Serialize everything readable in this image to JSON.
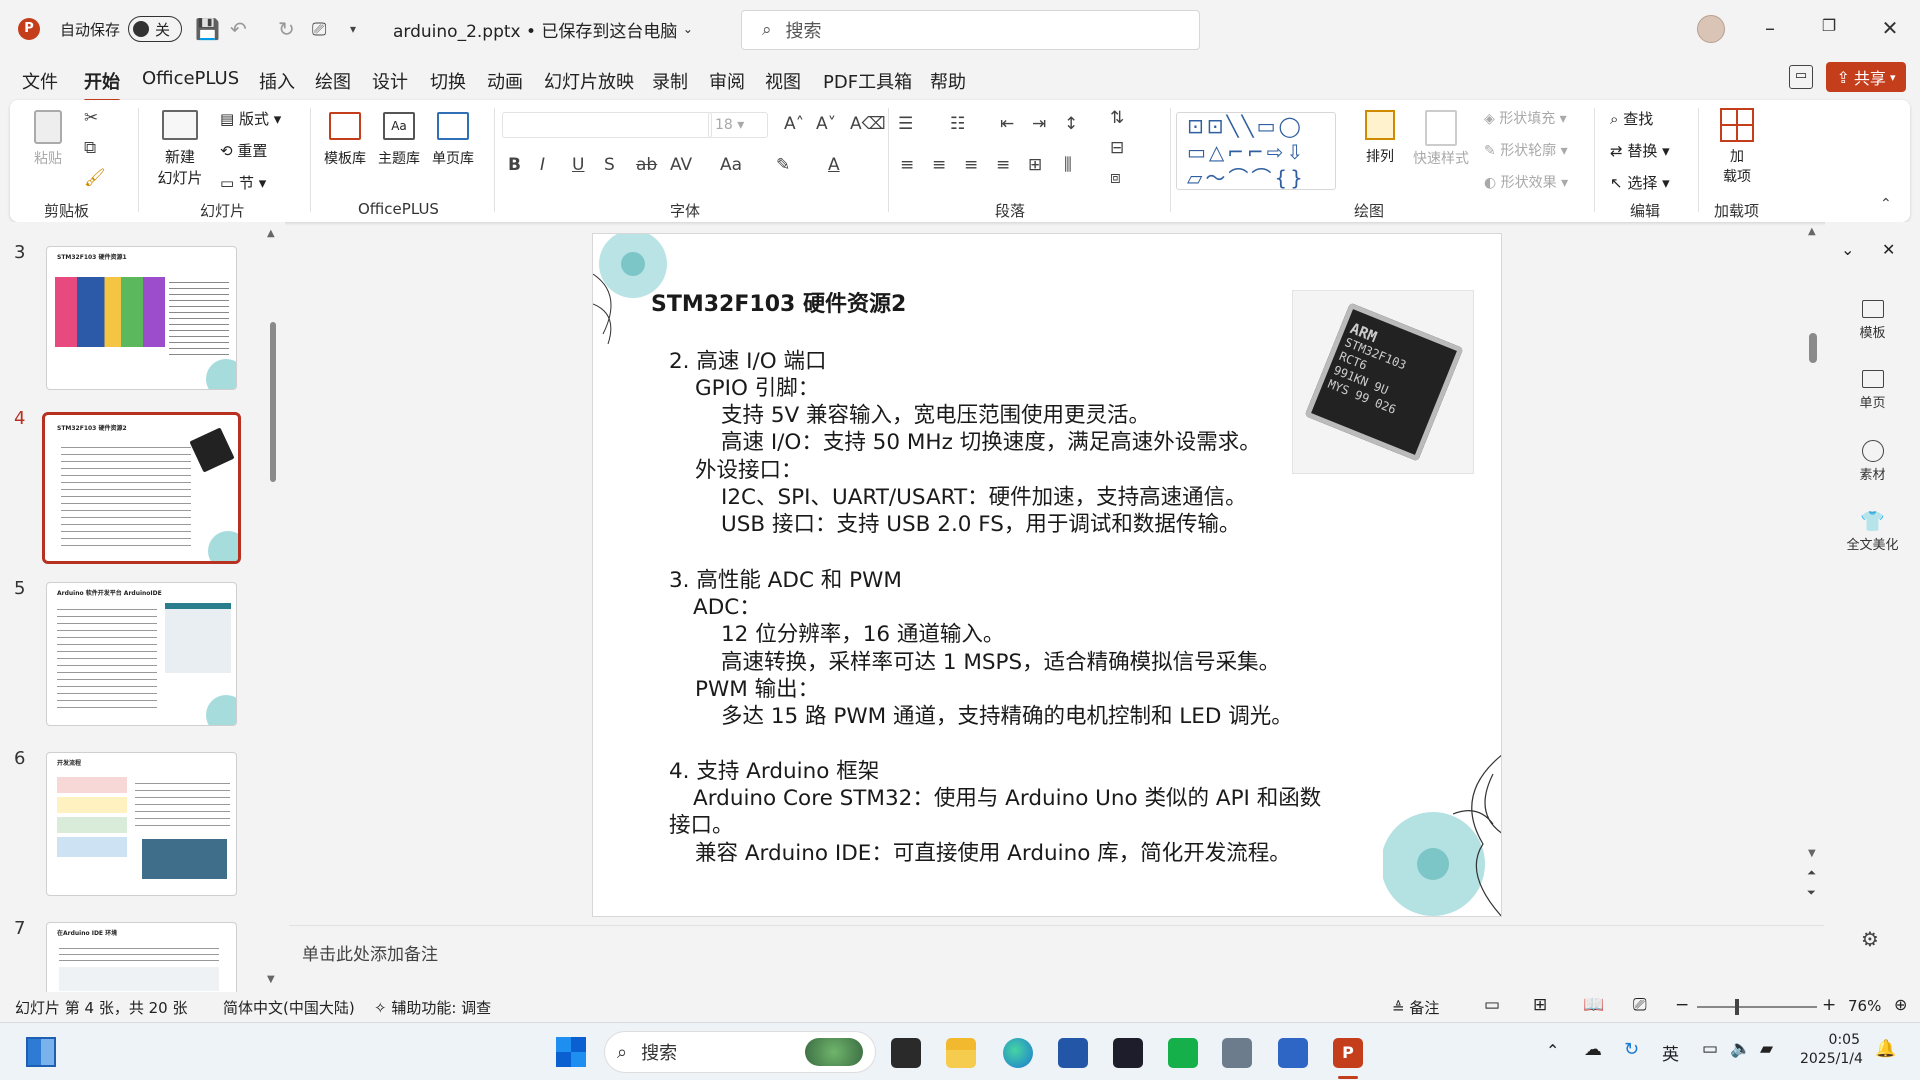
{
  "titlebar": {
    "autosave_label": "自动保存",
    "autosave_state": "关",
    "doc_title": "arduino_2.pptx • 已保存到这台电脑",
    "search_placeholder": "搜索"
  },
  "menu": [
    "文件",
    "开始",
    "OfficePLUS",
    "插入",
    "绘图",
    "设计",
    "切换",
    "动画",
    "幻灯片放映",
    "录制",
    "审阅",
    "视图",
    "PDF工具箱",
    "帮助"
  ],
  "share_label": "共享",
  "ribbon": {
    "clipboard": {
      "paste": "粘贴",
      "label": "剪贴板"
    },
    "slides": {
      "new_slide_1": "新建",
      "new_slide_2": "幻灯片",
      "layout": "版式",
      "reset": "重置",
      "section": "节",
      "label": "幻灯片"
    },
    "officeplus": {
      "templates": "模板库",
      "themes": "主题库",
      "single_page": "单页库",
      "label": "OfficePLUS"
    },
    "font": {
      "size": "18",
      "label": "字体"
    },
    "paragraph": {
      "label": "段落"
    },
    "drawing": {
      "arrange": "排列",
      "quick_styles": "快速样式",
      "fill": "形状填充",
      "outline": "形状轮廓",
      "effects": "形状效果",
      "label": "绘图"
    },
    "editing": {
      "find": "查找",
      "replace": "替换",
      "select": "选择",
      "label": "编辑"
    },
    "addins": {
      "addins_1": "加",
      "addins_2": "载项",
      "label": "加载项"
    }
  },
  "thumbnails": [
    {
      "num": "3",
      "title": "STM32F103 硬件资源1"
    },
    {
      "num": "4",
      "title": "STM32F103 硬件资源2"
    },
    {
      "num": "5",
      "title": "Arduino 软件开发平台 ArduinoIDE"
    },
    {
      "num": "6",
      "title": "开发流程"
    },
    {
      "num": "7",
      "title": "在Arduino IDE 环境"
    }
  ],
  "slide": {
    "title": "STM32F103 硬件资源2",
    "lines": [
      "2. 高速 I/O 端口",
      "GPIO 引脚：",
      "支持 5V 兼容输入，宽电压范围使用更灵活。",
      "高速 I/O：支持 50 MHz 切换速度，满足高速外设需求。",
      "外设接口：",
      "I2C、SPI、UART/USART：硬件加速，支持高速通信。",
      "USB 接口：支持 USB 2.0 FS，用于调试和数据传输。",
      "3. 高性能 ADC 和 PWM",
      "ADC：",
      "12 位分辨率，16 通道输入。",
      "高速转换，采样率可达 1 MSPS，适合精确模拟信号采集。",
      "PWM 输出：",
      "多达 15 路 PWM 通道，支持精确的电机控制和 LED 调光。",
      "4. 支持 Arduino 框架",
      "Arduino Core STM32：使用与 Arduino Uno 类似的 API 和函数",
      "接口。",
      "兼容 Arduino IDE：可直接使用 Arduino 库，简化开发流程。"
    ],
    "chip_text": [
      "ARM",
      "STM32F103",
      "RCT6",
      "991KN 9U",
      "MYS 99 026"
    ]
  },
  "notes_placeholder": "单击此处添加备注",
  "right_pane": [
    "模板",
    "单页",
    "素材",
    "全文美化"
  ],
  "status": {
    "slide_info": "幻灯片 第 4 张，共 20 张",
    "language": "简体中文(中国大陆)",
    "accessibility": "辅助功能: 调查",
    "notes": "备注",
    "zoom": "76%"
  },
  "taskbar": {
    "search": "搜索",
    "ime": "英",
    "time": "0:05",
    "date": "2025/1/4"
  },
  "colors": {
    "accent": "#c43e1c",
    "selection": "#b73020",
    "teal": "#7cc6c8"
  }
}
